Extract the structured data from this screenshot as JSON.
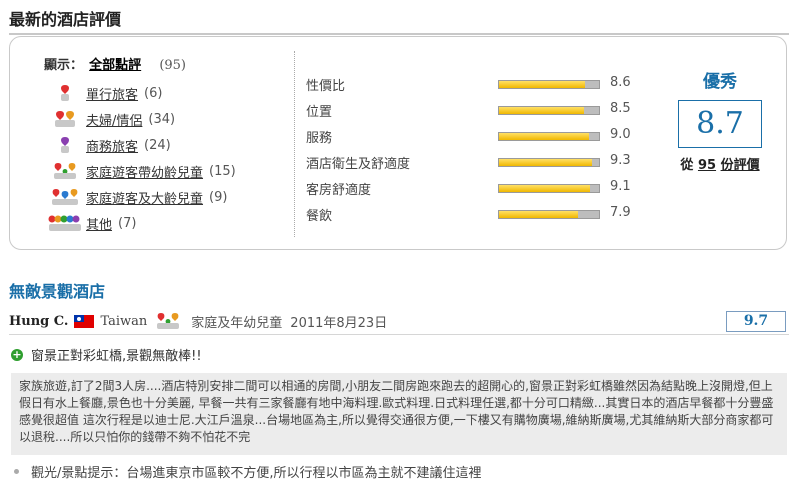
{
  "header": {
    "title": "最新的酒店評價"
  },
  "filters": {
    "label": "顯示：",
    "all_label": "全部點評",
    "all_count": "(95)",
    "items": [
      {
        "label": "單行旅客",
        "count": "(6)",
        "icon": "single-traveler-icon"
      },
      {
        "label": "夫婦/情侶",
        "count": "(34)",
        "icon": "couple-icon"
      },
      {
        "label": "商務旅客",
        "count": "(24)",
        "icon": "business-traveler-icon"
      },
      {
        "label": "家庭遊客帶幼齡兒童",
        "count": "(15)",
        "icon": "family-young-children-icon"
      },
      {
        "label": "家庭遊客及大齡兒童",
        "count": "(9)",
        "icon": "family-older-children-icon"
      },
      {
        "label": "其他",
        "count": "(7)",
        "icon": "group-icon"
      }
    ]
  },
  "ratings": [
    {
      "label": "性價比",
      "value": "8.6",
      "fraction": 0.86
    },
    {
      "label": "位置",
      "value": "8.5",
      "fraction": 0.85
    },
    {
      "label": "服務",
      "value": "9.0",
      "fraction": 0.9
    },
    {
      "label": "酒店衛生及舒適度",
      "value": "9.3",
      "fraction": 0.93
    },
    {
      "label": "客房舒適度",
      "value": "9.1",
      "fraction": 0.91
    },
    {
      "label": "餐飲",
      "value": "7.9",
      "fraction": 0.79
    }
  ],
  "overall": {
    "word": "優秀",
    "score": "8.7",
    "from_prefix": "從",
    "count": "95",
    "from_suffix": "份評價"
  },
  "review": {
    "title": "無敵景觀酒店",
    "reviewer": "Hung C.",
    "country": "Taiwan",
    "traveler_type": "家庭及年幼兒童",
    "date": "2011年8月23日",
    "score": "9.7",
    "pro": "窗景正對彩虹橋,景觀無敵棒!!",
    "body": "家族旅遊,訂了2間3人房....酒店特別安排二間可以相通的房間,小朋友二間房跑來跑去的超開心的,窗景正對彩虹橋雖然因為結點晚上沒開燈,但上假日有水上餐廳,景色也十分美麗, 早餐一共有三家餐廳有地中海料理.歐式料理.日式料理任選,都十分可口精緻...其實日本的酒店早餐都十分豐盛感覺很超值 這次行程是以迪士尼.大江戶溫泉...台場地區為主,所以覺得交通很方便,一下樓又有購物廣場,維納斯廣場,尤其維納斯大部分商家都可以退稅....所以只怕你的錢帶不夠不怕花不完",
    "tip": "觀光/景點提示：台場進東京市區較不方便,所以行程以市區為主就不建議住這裡"
  },
  "colors": {
    "accent": "#1a6fa8",
    "bar_fill": "#f0b800",
    "bar_track": "#bdbdbd"
  }
}
